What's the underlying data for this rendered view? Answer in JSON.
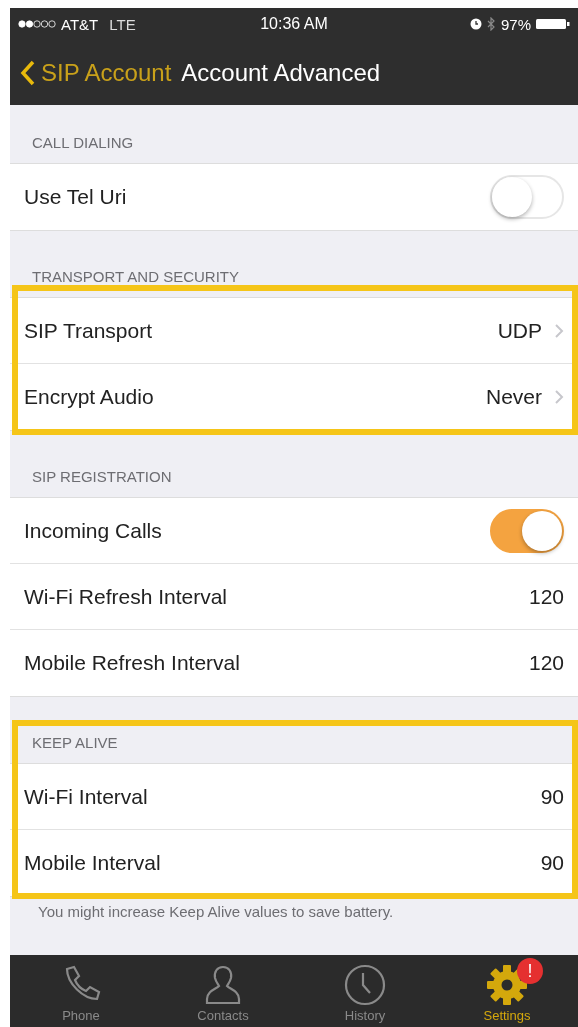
{
  "status_bar": {
    "carrier": "AT&T",
    "network": "LTE",
    "time": "10:36 AM",
    "battery": "97%"
  },
  "nav": {
    "back": "SIP Account",
    "title": "Account Advanced"
  },
  "sections": [
    {
      "header": "CALL DIALING",
      "highlighted": false,
      "rows": [
        {
          "kind": "toggle",
          "label": "Use Tel Uri",
          "on": false
        }
      ]
    },
    {
      "header": "TRANSPORT AND SECURITY",
      "highlighted": true,
      "rows": [
        {
          "kind": "disclosure",
          "label": "SIP Transport",
          "value": "UDP"
        },
        {
          "kind": "disclosure",
          "label": "Encrypt Audio",
          "value": "Never"
        }
      ]
    },
    {
      "header": "SIP REGISTRATION",
      "highlighted": false,
      "rows": [
        {
          "kind": "toggle",
          "label": "Incoming Calls",
          "on": true
        },
        {
          "kind": "value",
          "label": "Wi-Fi Refresh Interval",
          "value": "120"
        },
        {
          "kind": "value",
          "label": "Mobile Refresh Interval",
          "value": "120"
        }
      ]
    },
    {
      "header": "KEEP ALIVE",
      "highlighted": true,
      "rows": [
        {
          "kind": "value",
          "label": "Wi-Fi Interval",
          "value": "90"
        },
        {
          "kind": "value",
          "label": "Mobile Interval",
          "value": "90"
        }
      ],
      "footer": "You might increase Keep Alive values to save battery."
    }
  ],
  "tabs": [
    {
      "kind": "phone",
      "label": "Phone",
      "selected": false
    },
    {
      "kind": "contacts",
      "label": "Contacts",
      "selected": false
    },
    {
      "kind": "history",
      "label": "History",
      "selected": false
    },
    {
      "kind": "settings",
      "label": "Settings",
      "selected": true,
      "badge": "!"
    }
  ]
}
